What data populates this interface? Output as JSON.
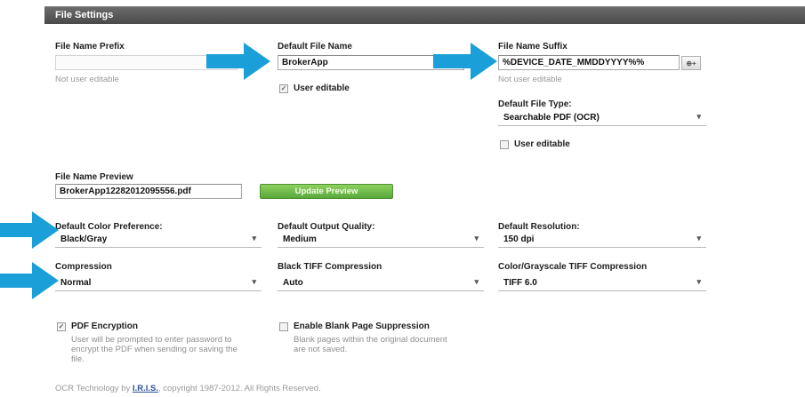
{
  "header": {
    "title": "File Settings"
  },
  "prefix": {
    "label": "File Name Prefix",
    "note": "Not user editable"
  },
  "default_name": {
    "label": "Default File Name",
    "value": "BrokerApp",
    "user_editable_label": "User editable",
    "user_editable_checked": true
  },
  "suffix": {
    "label": "File Name Suffix",
    "value": "%DEVICE_DATE_MMDDYYYY%%",
    "insert_button_label": "⊕+",
    "note": "Not user editable"
  },
  "file_type": {
    "label": "Default File Type:",
    "value": "Searchable PDF (OCR)",
    "user_editable_label": "User editable",
    "user_editable_checked": false
  },
  "preview": {
    "label": "File Name Preview",
    "value": "BrokerApp12282012095556.pdf",
    "update_button_label": "Update Preview"
  },
  "color_pref": {
    "label": "Default Color Preference:",
    "value": "Black/Gray"
  },
  "output_quality": {
    "label": "Default Output Quality:",
    "value": "Medium"
  },
  "resolution": {
    "label": "Default Resolution:",
    "value": "150 dpi"
  },
  "compression": {
    "label": "Compression",
    "value": "Normal"
  },
  "black_tiff": {
    "label": "Black TIFF Compression",
    "value": "Auto"
  },
  "color_tiff": {
    "label": "Color/Grayscale TIFF Compression",
    "value": "TIFF 6.0"
  },
  "pdf_encryption": {
    "label": "PDF Encryption",
    "checked": true,
    "description": "User will be prompted to enter password to encrypt the PDF when sending or saving the file."
  },
  "blank_page": {
    "label": "Enable Blank Page Suppression",
    "checked": false,
    "description": "Blank pages within the original document are not saved."
  },
  "footer": {
    "prefix": "OCR Technology by ",
    "link": "I.R.I.S.",
    "suffix": ", copyright 1987-2012. All Rights Reserved."
  },
  "colors": {
    "arrow": "#1a9fd9",
    "header_bar": "#555555",
    "update_button": "#6cba45",
    "link": "#2a4f9e"
  }
}
